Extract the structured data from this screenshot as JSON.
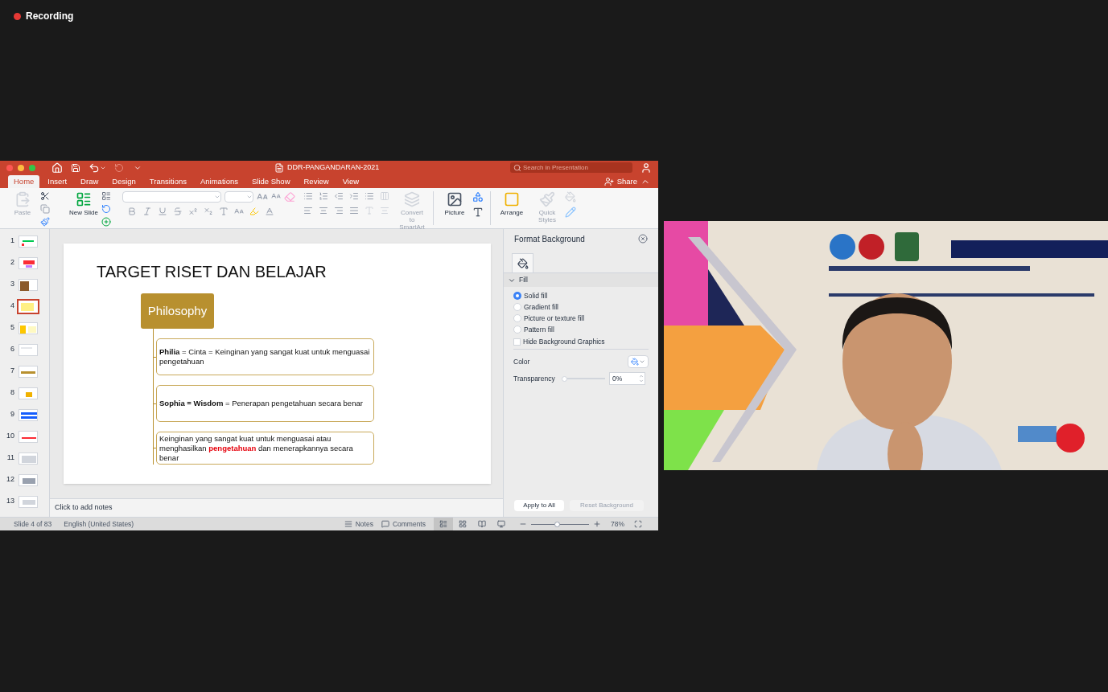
{
  "recording": {
    "label": "Recording",
    "on": true
  },
  "window": {
    "title": "DDR-PANGANDARAN-2021",
    "search": {
      "placeholder": "Search in Presentation"
    },
    "share": "Share"
  },
  "tabs": [
    {
      "label": "Home",
      "selected": true
    },
    {
      "label": "Insert",
      "selected": false
    },
    {
      "label": "Draw",
      "selected": false
    },
    {
      "label": "Design",
      "selected": false
    },
    {
      "label": "Transitions",
      "selected": false
    },
    {
      "label": "Animations",
      "selected": false
    },
    {
      "label": "Slide Show",
      "selected": false
    },
    {
      "label": "Review",
      "selected": false
    },
    {
      "label": "View",
      "selected": false
    }
  ],
  "ribbon": {
    "buttons": [
      {
        "kind": "paste",
        "label": "Paste",
        "disabled": true
      },
      {
        "kind": "new-slide",
        "label": "New Slide",
        "disabled": false
      },
      {
        "kind": "smartart",
        "label": "Convert to SmartArt",
        "disabled": true
      },
      {
        "kind": "picture",
        "label": "Picture",
        "disabled": false
      },
      {
        "kind": "arrange",
        "label": "Arrange",
        "disabled": false
      },
      {
        "kind": "quick-styles",
        "label": "Quick Styles",
        "disabled": true
      }
    ]
  },
  "thumbnails": [
    {
      "number": "1",
      "selected": false
    },
    {
      "number": "2",
      "selected": false
    },
    {
      "number": "3",
      "selected": false
    },
    {
      "number": "4",
      "selected": true
    },
    {
      "number": "5",
      "selected": false
    },
    {
      "number": "6",
      "selected": false
    },
    {
      "number": "7",
      "selected": false
    },
    {
      "number": "8",
      "selected": false
    },
    {
      "number": "9",
      "selected": false
    },
    {
      "number": "10",
      "selected": false
    },
    {
      "number": "11",
      "selected": false
    },
    {
      "number": "12",
      "selected": false
    },
    {
      "number": "13",
      "selected": false
    }
  ],
  "slide": {
    "title": "TARGET RISET DAN BELAJAR",
    "root": "Philosophy",
    "boxes": [
      {
        "kind": "definition",
        "text": "**Philia** = Cinta = Keinginan yang sangat kuat untuk menguasai pengetahuan"
      },
      {
        "kind": "definition",
        "text": "**Sophia = Wisdom** = Penerapan pengetahuan secara benar"
      },
      {
        "kind": "emphasis",
        "text": "Keinginan yang sangat kuat untuk menguasai atau menghasilkan **pengetahuan** dan menerapkannya secara benar"
      }
    ]
  },
  "notes": {
    "placeholder": "Click to add notes"
  },
  "panel": {
    "title": "Format Background",
    "section": {
      "label": "Fill",
      "expanded": true
    },
    "fill_options": [
      {
        "label": "Solid fill",
        "selected": true
      },
      {
        "label": "Gradient fill",
        "selected": false
      },
      {
        "label": "Picture or texture fill",
        "selected": false
      },
      {
        "label": "Pattern fill",
        "selected": false
      }
    ],
    "hide_graphics": {
      "label": "Hide Background Graphics",
      "checked": false
    },
    "color": {
      "label": "Color"
    },
    "transparency": {
      "label": "Transparency",
      "level": 0,
      "value": "0%"
    },
    "buttons": [
      {
        "label": "Apply to All",
        "disabled": false
      },
      {
        "label": "Reset Background",
        "disabled": true
      }
    ]
  },
  "status": {
    "slide": "Slide 4 of 83",
    "language": "English (United States)",
    "notes": "Notes",
    "comments": "Comments",
    "views": [
      {
        "selected": true
      },
      {
        "selected": false
      },
      {
        "selected": false
      },
      {
        "selected": false
      }
    ],
    "zoom": {
      "level": 0.45,
      "value": "78%"
    }
  }
}
